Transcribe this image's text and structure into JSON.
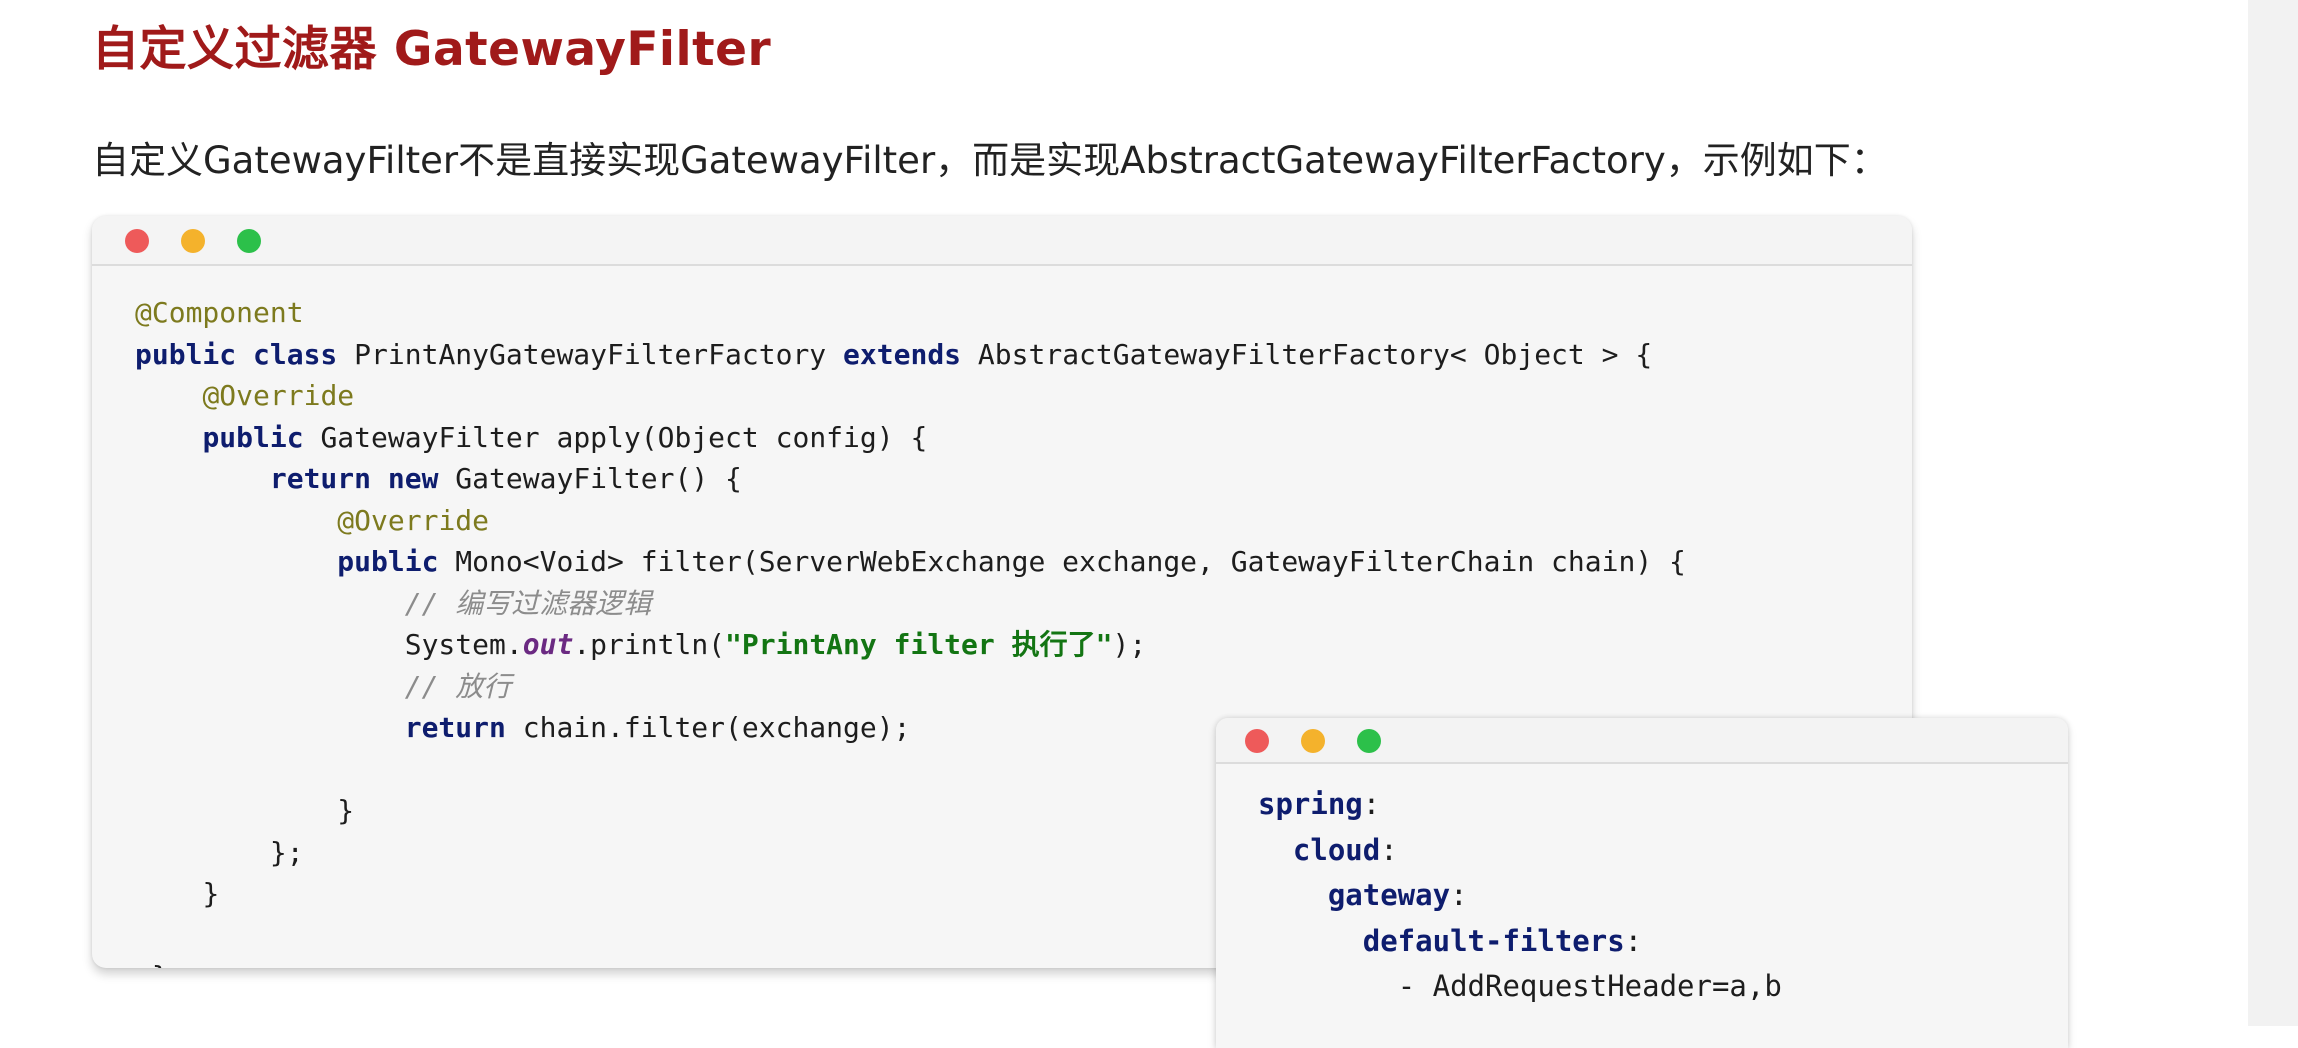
{
  "heading": "自定义过滤器 GatewayFilter",
  "intro": "自定义GatewayFilter不是直接实现GatewayFilter，而是实现AbstractGatewayFilterFactory，示例如下：",
  "java_code": {
    "l1": "@Component",
    "l2_kw1": "public class",
    "l2_cls": " PrintAnyGatewayFilterFactory ",
    "l2_kw2": "extends",
    "l2_rest": " AbstractGatewayFilterFactory< Object > {",
    "l3": "@Override",
    "l4_kw": "public",
    "l4_rest": " GatewayFilter apply(Object config) {",
    "l5_kw1": "return",
    "l5_kw2": "new",
    "l5_rest": " GatewayFilter() {",
    "l6": "@Override",
    "l7_kw": "public",
    "l7_rest": " Mono<Void> filter(ServerWebExchange exchange, GatewayFilterChain chain) {",
    "l8": "// 编写过滤器逻辑",
    "l9_pre": "System.",
    "l9_out": "out",
    "l9_mid": ".println(",
    "l9_str": "\"PrintAny filter 执行了\"",
    "l9_end": ");",
    "l10": "// 放行",
    "l11_kw": "return",
    "l11_rest": " chain.filter(exchange);",
    "l12": "}",
    "l13": "};",
    "l14": "}",
    "l15": "}"
  },
  "yaml_code": {
    "k1": "spring",
    "k2": "cloud",
    "k3": "gateway",
    "k4": "default-filters",
    "item": "- AddRequestHeader=a,b"
  },
  "colors": {
    "heading": "#a01a1a",
    "keyword": "#0e1d6e",
    "annotation": "#7d7a1e",
    "string": "#137513",
    "comment": "#8c8c8c",
    "static_field": "#6b2a82",
    "dot_red": "#ee5a5a",
    "dot_yellow": "#f4b22c",
    "dot_green": "#2cc04a"
  }
}
